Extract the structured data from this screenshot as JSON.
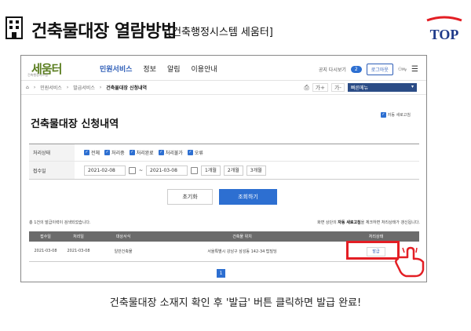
{
  "header": {
    "title": "건축물대장 열람방법",
    "subtitle": "[건축행정시스템 세움터]",
    "logo_text": "TOP"
  },
  "site": {
    "brand": "세움터",
    "brand_sub": "건축행정시스템",
    "menu": [
      "민원서비스",
      "정보",
      "알림",
      "이용안내"
    ],
    "notice_label": "공지 다시보기",
    "notice_count": "2",
    "login_label": "로그아웃",
    "user_label": "My"
  },
  "breadcrumb": {
    "items": [
      "민원서비스",
      "발급서비스"
    ],
    "current": "건축물대장 신청내역",
    "tools": [
      "가+",
      "가-"
    ],
    "quick_select": "빠른메뉴"
  },
  "page": {
    "title": "건축물대장 신청내역",
    "auto_refresh": "자동 새로고침"
  },
  "filter": {
    "status_label": "처리상태",
    "status_options": [
      "전체",
      "처리중",
      "처리완료",
      "처리불가",
      "오류"
    ],
    "date_label": "접수일",
    "date_from": "2021-02-08",
    "date_to": "2021-03-08",
    "date_sep": "~",
    "range_buttons": [
      "1개월",
      "2개월",
      "3개월"
    ]
  },
  "actions": {
    "reset": "초기화",
    "search": "조회하기"
  },
  "results": {
    "count_text": "총 1건의 발급이력이 검색되었습니다.",
    "note_prefix": "화면 상단의",
    "note_bold": "자동 새로고침",
    "note_suffix": "을 체크하면 처리상태가 갱신됩니다.",
    "columns": [
      "접수일",
      "처리일",
      "대상서식",
      "건축물 위치",
      "처리상태"
    ],
    "rows": [
      {
        "received": "2021-03-08",
        "processed": "2021-03-08",
        "form": "일반건축물",
        "location": "서울특별시 강남구 삼성동 142-34 탑빌딩",
        "status_button": "발급"
      }
    ],
    "page": "1"
  },
  "caption": "건축물대장 소재지 확인 후 '발급' 버튼 클릭하면 발급 완료!",
  "colors": {
    "accent": "#2d6fd1",
    "highlight": "#e31e24",
    "header_dark": "#2b4c86",
    "brand_green": "#5a7d1f"
  }
}
